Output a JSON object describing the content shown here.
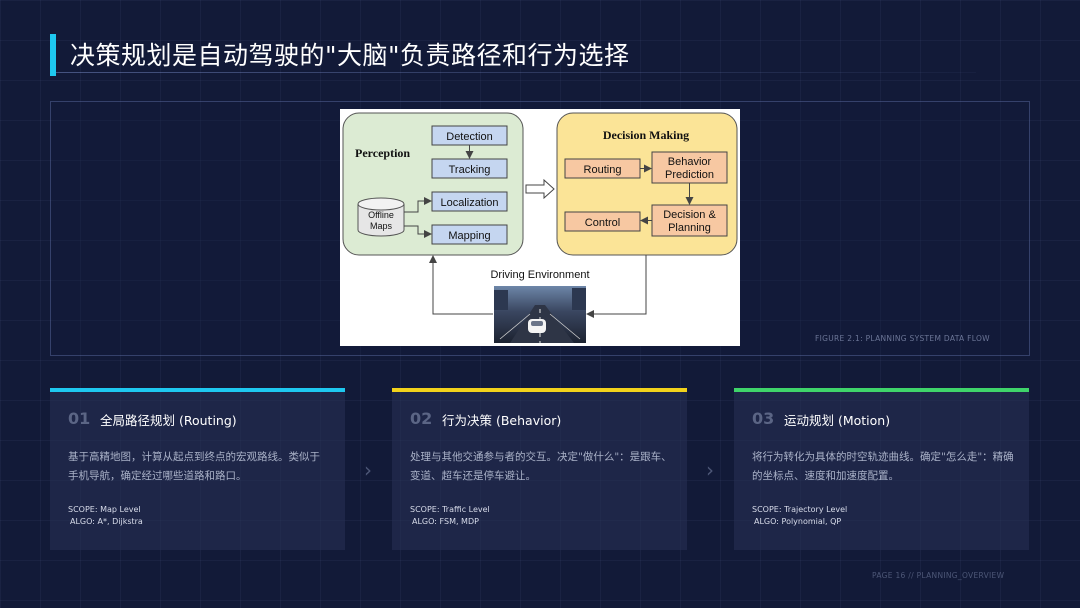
{
  "header": {
    "title": "决策规划是自动驾驶的\"大脑\"负责路径和行为选择"
  },
  "figure": {
    "caption": "FIGURE 2.1: PLANNING SYSTEM DATA FLOW",
    "perception": {
      "title": "Perception",
      "detection": "Detection",
      "tracking": "Tracking",
      "localization": "Localization",
      "mapping": "Mapping",
      "offline_maps_l1": "Offline",
      "offline_maps_l2": "Maps"
    },
    "decision": {
      "title": "Decision Making",
      "routing": "Routing",
      "behavior_l1": "Behavior",
      "behavior_l2": "Prediction",
      "control": "Control",
      "planning_l1": "Decision &",
      "planning_l2": "Planning"
    },
    "environment": "Driving Environment"
  },
  "cards": [
    {
      "num": "01",
      "title": "全局路径规划 (Routing)",
      "desc": "基于高精地图，计算从起点到终点的宏观路线。类似于手机导航，确定经过哪些道路和路口。",
      "scope": "SCOPE: Map Level",
      "algo": "ALGO: A*, Dijkstra",
      "color": "#1ec8f0"
    },
    {
      "num": "02",
      "title": "行为决策 (Behavior)",
      "desc": "处理与其他交通参与者的交互。决定\"做什么\"：是跟车、变道、超车还是停车避让。",
      "scope": "SCOPE: Traffic Level",
      "algo": "ALGO: FSM, MDP",
      "color": "#f2d21b"
    },
    {
      "num": "03",
      "title": "运动规划 (Motion)",
      "desc": "将行为转化为具体的时空轨迹曲线。确定\"怎么走\"：精确的坐标点、速度和加速度配置。",
      "scope": "SCOPE: Trajectory Level",
      "algo": "ALGO: Polynomial, QP",
      "color": "#3fd46a"
    }
  ],
  "footer": {
    "page": "PAGE 16 // PLANNING_OVERVIEW"
  }
}
